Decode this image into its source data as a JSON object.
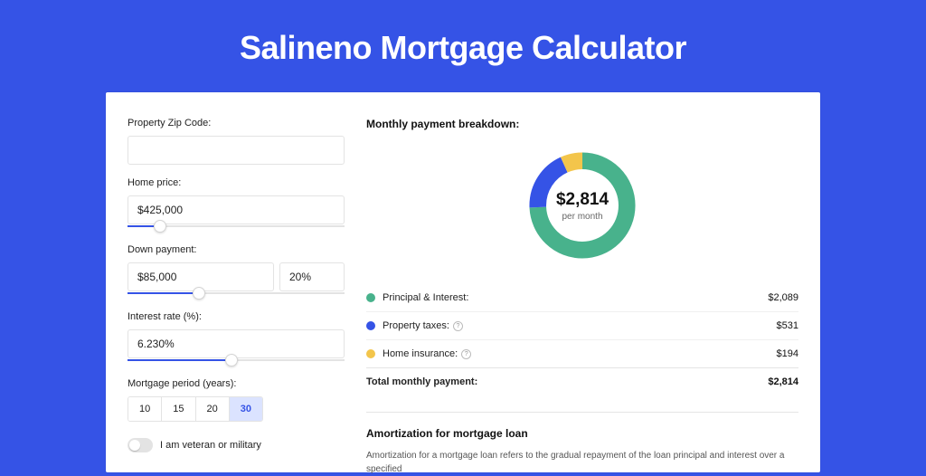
{
  "hero": {
    "title": "Salineno Mortgage Calculator"
  },
  "form": {
    "zip": {
      "label": "Property Zip Code:",
      "value": ""
    },
    "home": {
      "label": "Home price:",
      "value": "$425,000",
      "slider_pct": 12
    },
    "down": {
      "label": "Down payment:",
      "value": "$85,000",
      "pct": "20%",
      "slider_pct": 30
    },
    "rate": {
      "label": "Interest rate (%):",
      "value": "6.230%",
      "slider_pct": 45
    },
    "period": {
      "label": "Mortgage period (years):",
      "options": [
        "10",
        "15",
        "20",
        "30"
      ],
      "active": "30"
    },
    "veteran": {
      "label": "I am veteran or military",
      "on": false
    }
  },
  "breakdown": {
    "title": "Monthly payment breakdown:",
    "total": "$2,814",
    "per_month": "per month",
    "items": [
      {
        "label": "Principal & Interest:",
        "value": "$2,089",
        "color": "#48b28c",
        "info": false
      },
      {
        "label": "Property taxes:",
        "value": "$531",
        "color": "#3553e6",
        "info": true
      },
      {
        "label": "Home insurance:",
        "value": "$194",
        "color": "#f3c54b",
        "info": true
      }
    ],
    "total_row": {
      "label": "Total monthly payment:",
      "value": "$2,814"
    }
  },
  "amort": {
    "title": "Amortization for mortgage loan",
    "text": "Amortization for a mortgage loan refers to the gradual repayment of the loan principal and interest over a specified"
  },
  "chart_data": {
    "type": "pie",
    "title": "Monthly payment breakdown",
    "categories": [
      "Principal & Interest",
      "Property taxes",
      "Home insurance"
    ],
    "values": [
      2089,
      531,
      194
    ],
    "colors": [
      "#48b28c",
      "#3553e6",
      "#f3c54b"
    ],
    "total": 2814,
    "center_label": "$2,814 per month"
  }
}
